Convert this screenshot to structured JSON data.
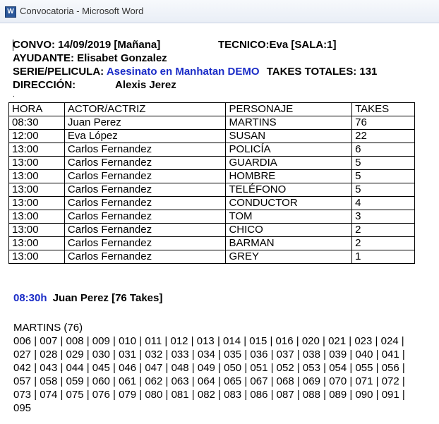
{
  "window": {
    "title": "Convocatoria - Microsoft Word",
    "icon": "word-doc-icon"
  },
  "header": {
    "convo_label": "CONVO:",
    "convo_value": "14/09/2019 [Mañana]",
    "tecnico_label": "TECNICO:",
    "tecnico_value": "Eva [SALA:1]",
    "ayudante_label": "AYUDANTE:",
    "ayudante_value": "Elisabet Gonzalez",
    "serie_label": "SERIE/PELICULA:",
    "serie_value": "Asesinato en Manhatan DEMO",
    "takes_totales_label": "TAKES TOTALES:",
    "takes_totales_value": "131",
    "direccion_label": "DIRECCIÓN:",
    "direccion_value": "Alexis Jerez",
    "separator_dot": "."
  },
  "table": {
    "columns": [
      "HORA",
      "ACTOR/ACTRIZ",
      "PERSONAJE",
      "TAKES"
    ],
    "rows": [
      [
        "08:30",
        "Juan Perez",
        "MARTINS",
        "76"
      ],
      [
        "12:00",
        "Eva López",
        "SUSAN",
        "22"
      ],
      [
        "13:00",
        "Carlos Fernandez",
        "POLICÍA",
        "6"
      ],
      [
        "13:00",
        "Carlos Fernandez",
        "GUARDIA",
        "5"
      ],
      [
        "13:00",
        "Carlos Fernandez",
        "HOMBRE",
        "5"
      ],
      [
        "13:00",
        "Carlos Fernandez",
        "TELÉFONO",
        "5"
      ],
      [
        "13:00",
        "Carlos Fernandez",
        "CONDUCTOR",
        "4"
      ],
      [
        "13:00",
        "Carlos Fernandez",
        "TOM",
        "3"
      ],
      [
        "13:00",
        "Carlos Fernandez",
        "CHICO",
        "2"
      ],
      [
        "13:00",
        "Carlos Fernandez",
        "BARMAN",
        "2"
      ],
      [
        "13:00",
        "Carlos Fernandez",
        "GREY",
        "1"
      ]
    ]
  },
  "section": {
    "time": "08:30h",
    "actor_summary": "Juan Perez [76 Takes]"
  },
  "character_block": {
    "character": "MARTINS (76)",
    "takes": [
      "006",
      "007",
      "008",
      "009",
      "010",
      "011",
      "012",
      "013",
      "014",
      "015",
      "016",
      "020",
      "021",
      "023",
      "024",
      "027",
      "028",
      "029",
      "030",
      "031",
      "032",
      "033",
      "034",
      "035",
      "036",
      "037",
      "038",
      "039",
      "040",
      "041",
      "042",
      "043",
      "044",
      "045",
      "046",
      "047",
      "048",
      "049",
      "050",
      "051",
      "052",
      "053",
      "054",
      "055",
      "056",
      "057",
      "058",
      "059",
      "060",
      "061",
      "062",
      "063",
      "064",
      "065",
      "067",
      "068",
      "069",
      "070",
      "071",
      "072",
      "073",
      "074",
      "075",
      "076",
      "079",
      "080",
      "081",
      "082",
      "083",
      "086",
      "087",
      "088",
      "089",
      "090",
      "091",
      "095"
    ]
  }
}
